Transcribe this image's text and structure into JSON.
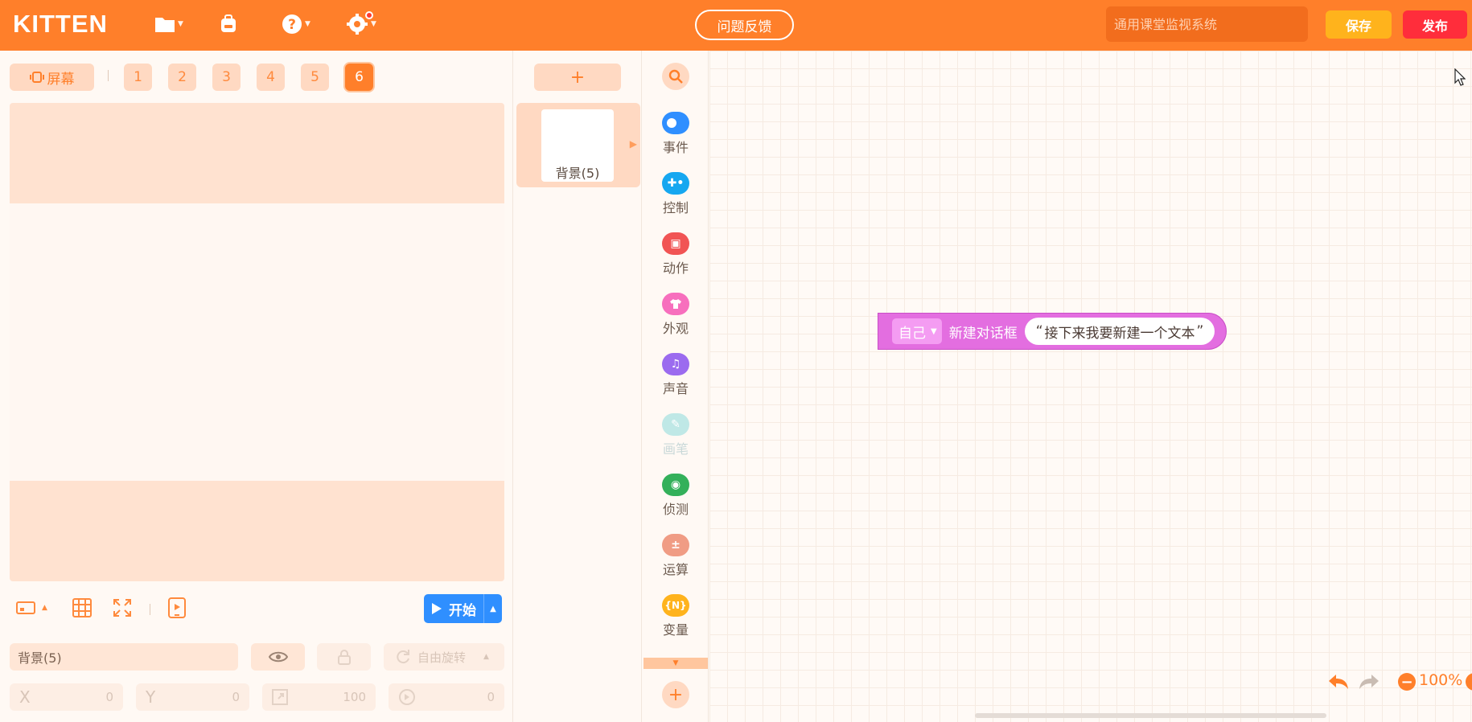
{
  "app": {
    "logo": "KITTEN"
  },
  "topbar": {
    "feedback_label": "问题反馈",
    "search_placeholder": "通用课堂监视系统",
    "save_label": "保存",
    "publish_label": "发布"
  },
  "stage": {
    "screen_label": "屏幕",
    "screens": [
      "1",
      "2",
      "3",
      "4",
      "5",
      "6"
    ],
    "active_screen": "6",
    "start_label": "开始"
  },
  "properties": {
    "name_value": "背景(5)",
    "rotate_label": "自由旋转",
    "x_label": "X",
    "x_value": "0",
    "y_label": "Y",
    "y_value": "0",
    "size_value": "100",
    "direction_value": "0"
  },
  "sprites": {
    "add_label": "+",
    "items": [
      {
        "label": "背景(5)"
      }
    ]
  },
  "categories": [
    {
      "name": "事件",
      "color": "#2f8fff",
      "icon": "toggle-icon"
    },
    {
      "name": "控制",
      "color": "#16a7f0",
      "icon": "gamepad-icon"
    },
    {
      "name": "动作",
      "color": "#f15454",
      "icon": "robot-icon"
    },
    {
      "name": "外观",
      "color": "#f76fbd",
      "icon": "shirt-icon"
    },
    {
      "name": "声音",
      "color": "#9b6bef",
      "icon": "music-icon"
    },
    {
      "name": "画笔",
      "color": "#bfe8e6",
      "icon": "pen-icon"
    },
    {
      "name": "侦测",
      "color": "#33b05a",
      "icon": "target-icon"
    },
    {
      "name": "运算",
      "color": "#f09c84",
      "icon": "math-icon"
    },
    {
      "name": "变量",
      "color": "#ffb31c",
      "icon": "variable-icon",
      "glyph": "{N}"
    }
  ],
  "workspace": {
    "block": {
      "target": "自己",
      "action": "新建对话框",
      "text_open": "“",
      "text_value": "接下来我要新建一个文本",
      "text_close": "”",
      "color": "#e36ee0"
    },
    "zoom": "100%"
  }
}
